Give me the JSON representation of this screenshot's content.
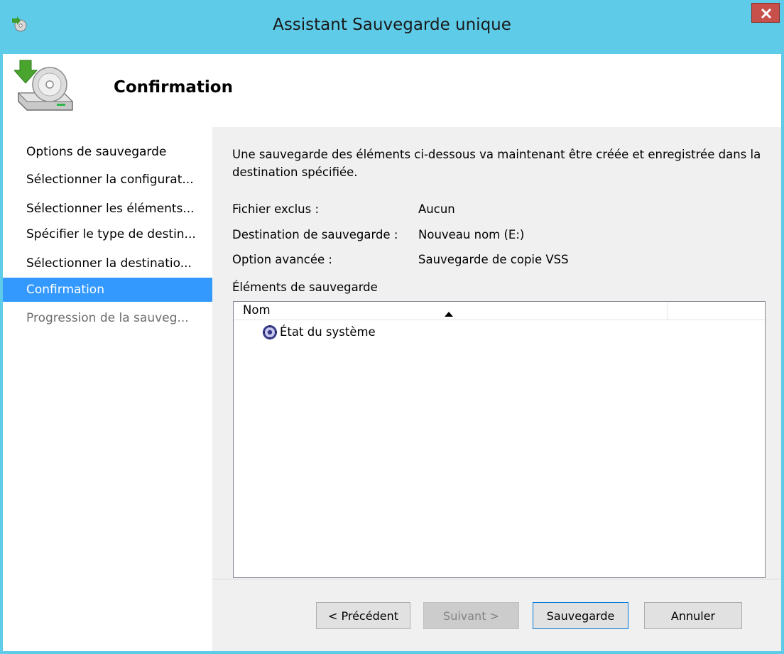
{
  "window": {
    "title": "Assistant Sauvegarde unique",
    "close_icon": "close-icon",
    "app_icon": "backup-app-icon"
  },
  "header": {
    "title": "Confirmation",
    "icon": "backup-drive-icon"
  },
  "sidebar": {
    "items": [
      {
        "label": "Options de sauvegarde",
        "state": "normal"
      },
      {
        "label": "Sélectionner la configurat...",
        "state": "normal"
      },
      {
        "label": "Sélectionner les éléments...",
        "state": "normal"
      },
      {
        "label": "Spécifier le type de destin...",
        "state": "normal"
      },
      {
        "label": "Sélectionner la destinatio...",
        "state": "normal"
      },
      {
        "label": "Confirmation",
        "state": "active"
      },
      {
        "label": "Progression de la sauveg...",
        "state": "disabled"
      }
    ]
  },
  "main": {
    "intro": "Une sauvegarde des éléments ci-dessous va maintenant être créée et enregistrée dans la destination spécifiée.",
    "details": [
      {
        "label": "Fichier exclus :",
        "value": "Aucun"
      },
      {
        "label": "Destination de sauvegarde :",
        "value": "Nouveau nom (E:)"
      },
      {
        "label": "Option avancée :",
        "value": "Sauvegarde de copie VSS"
      }
    ],
    "items_label": "Éléments de sauvegarde",
    "list": {
      "column_header": "Nom",
      "sort": "ascending",
      "rows": [
        {
          "label": "État du système",
          "icon": "system-state-icon"
        }
      ]
    }
  },
  "buttons": {
    "previous": "< Précédent",
    "next": "Suivant >",
    "backup": "Sauvegarde",
    "cancel": "Annuler"
  },
  "colors": {
    "titlebar": "#5ecbe8",
    "selection": "#3399ff",
    "close": "#c7504a"
  }
}
